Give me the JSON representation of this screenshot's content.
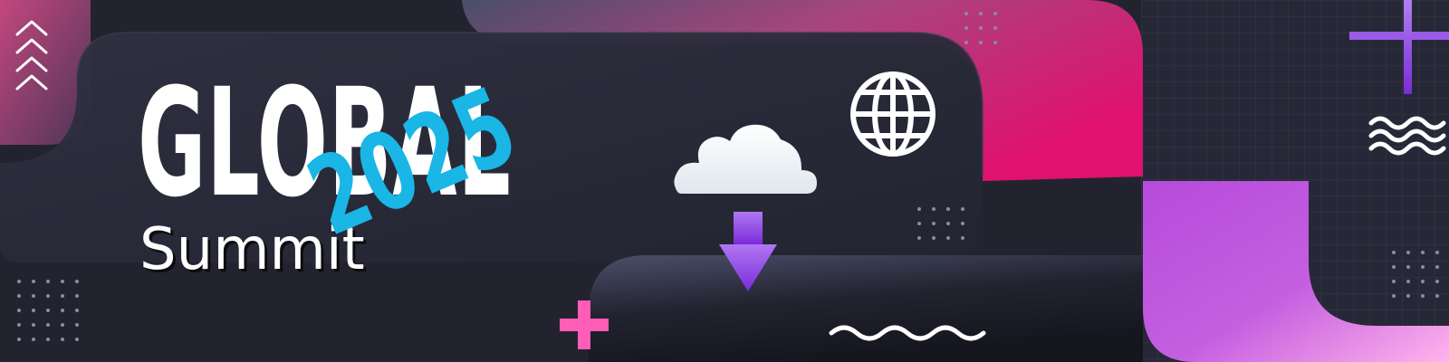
{
  "banner": {
    "title": "GLOBAL",
    "subtitle": "Summit",
    "year": "2025"
  },
  "icons": [
    "chevrons-up-icon",
    "globe-icon",
    "cloud-icon",
    "download-arrow-icon",
    "plus-icon",
    "wave-icon",
    "dots-grid-icon"
  ],
  "colors": {
    "background": "#23232f",
    "panel": "#2c2d3c",
    "magenta": "#e0116f",
    "violet": "#b64bdb",
    "pink": "#ff7ad0",
    "cyan": "#19b6e6",
    "purple": "#7b2bd9"
  }
}
